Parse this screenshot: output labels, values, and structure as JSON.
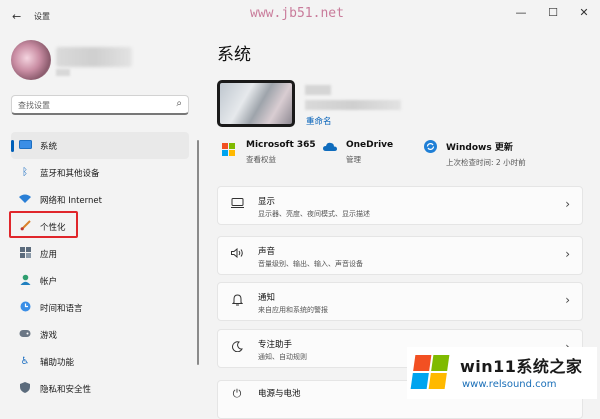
{
  "window": {
    "title": "设置",
    "back_glyph": "←",
    "controls": {
      "minimize": "—",
      "maximize": "☐",
      "close": "✕"
    }
  },
  "watermark_top": "www.jb51.net",
  "search": {
    "placeholder": "查找设置",
    "value": ""
  },
  "sidebar": {
    "items": [
      {
        "label": "系统",
        "icon": "system-display-icon",
        "active": true
      },
      {
        "label": "蓝牙和其他设备",
        "icon": "bluetooth-icon"
      },
      {
        "label": "网络和 Internet",
        "icon": "wifi-icon"
      },
      {
        "label": "个性化",
        "icon": "brush-icon"
      },
      {
        "label": "应用",
        "icon": "apps-icon"
      },
      {
        "label": "帐户",
        "icon": "account-icon"
      },
      {
        "label": "时间和语言",
        "icon": "globe-clock-icon"
      },
      {
        "label": "游戏",
        "icon": "gamepad-icon"
      },
      {
        "label": "辅助功能",
        "icon": "accessibility-icon"
      },
      {
        "label": "隐私和安全性",
        "icon": "shield-icon"
      }
    ]
  },
  "main": {
    "title": "系统",
    "rename_link": "重命名",
    "tiles": [
      {
        "title": "Microsoft 365",
        "subtitle": "查看权益",
        "icon": "microsoft-logo-icon"
      },
      {
        "title": "OneDrive",
        "subtitle": "管理",
        "icon": "cloud-icon"
      },
      {
        "title": "Windows 更新",
        "subtitle": "上次检查时间: 2 小时前",
        "icon": "sync-icon"
      }
    ],
    "cards": [
      {
        "title": "显示",
        "subtitle": "显示器、亮度、夜间模式、显示描述",
        "icon": "monitor-icon"
      },
      {
        "title": "声音",
        "subtitle": "音量级别、输出、输入、声音设备",
        "icon": "speaker-icon"
      },
      {
        "title": "通知",
        "subtitle": "来自应用和系统的警报",
        "icon": "bell-icon"
      },
      {
        "title": "专注助手",
        "subtitle": "通知、自动规则",
        "icon": "moon-icon"
      },
      {
        "title": "电源与电池",
        "subtitle": "",
        "icon": "power-icon"
      }
    ]
  },
  "watermark": {
    "title": "win11系统之家",
    "url": "www.relsound.com"
  },
  "colors": {
    "accent": "#005fb8",
    "highlight_box": "#e0262b",
    "ms_red": "#f25022",
    "ms_green": "#7fba00",
    "ms_blue": "#00a4ef",
    "ms_yellow": "#ffb900"
  }
}
